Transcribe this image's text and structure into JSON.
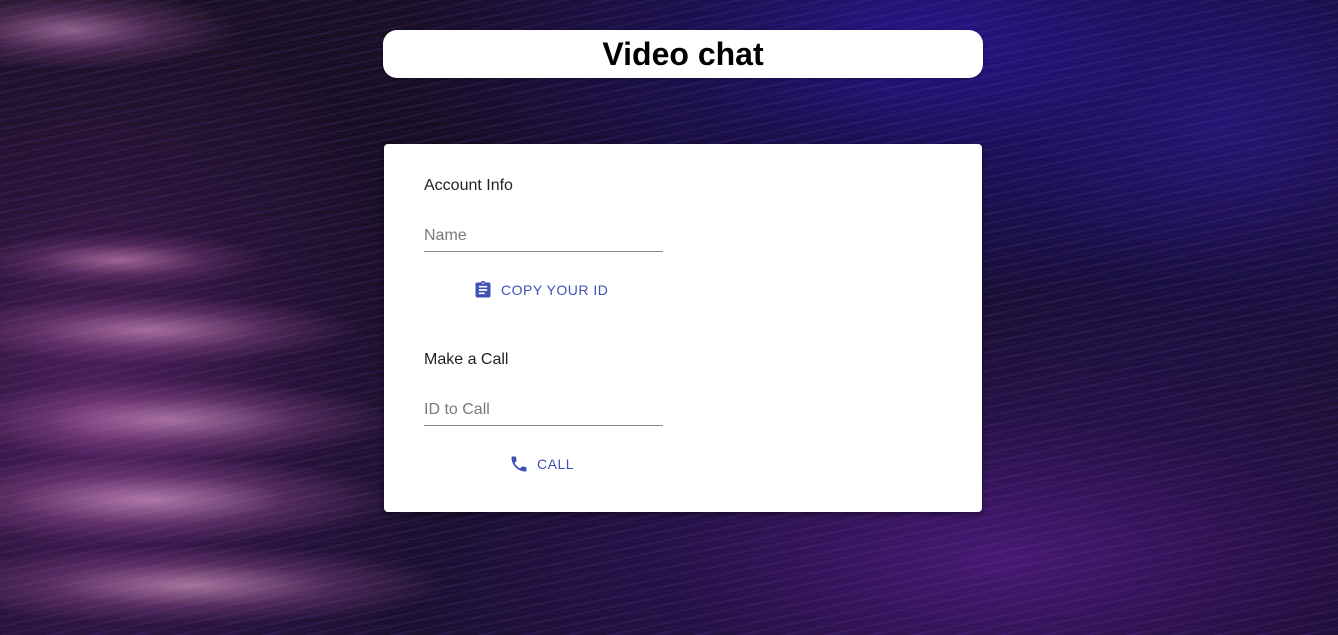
{
  "header": {
    "title": "Video chat"
  },
  "account_info": {
    "heading": "Account Info",
    "name_field": {
      "placeholder": "Name",
      "value": ""
    },
    "copy_button": {
      "label": "COPY YOUR ID",
      "icon": "clipboard-icon"
    }
  },
  "make_call": {
    "heading": "Make a Call",
    "id_field": {
      "placeholder": "ID to Call",
      "value": ""
    },
    "call_button": {
      "label": "CALL",
      "icon": "phone-icon"
    }
  },
  "colors": {
    "accent": "#3f51b5",
    "card_background": "#ffffff",
    "title_text": "#000000"
  }
}
